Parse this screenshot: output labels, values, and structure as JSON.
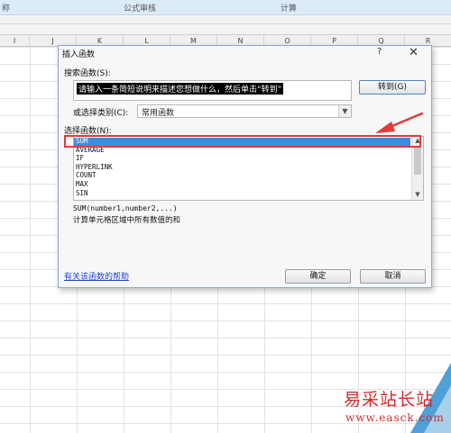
{
  "ribbon": {
    "left_fragment": "称",
    "group_audit": "公式审核",
    "group_calc": "计算"
  },
  "columns": [
    "I",
    "J",
    "K",
    "L",
    "M",
    "N",
    "O",
    "P",
    "Q",
    "R"
  ],
  "dialog": {
    "title": "插入函数",
    "help_glyph": "?",
    "close_glyph": "✕",
    "search_label": "搜索函数(S):",
    "search_value": "请输入一条简短说明来描述您想做什么，然后单击“转到”",
    "goto_button": "转到(G)",
    "category_label": "或选择类别(C):",
    "category_value": "常用函数",
    "function_list_label": "选择函数(N):",
    "functions": [
      "SUM",
      "AVERAGE",
      "IF",
      "HYPERLINK",
      "COUNT",
      "MAX",
      "SIN"
    ],
    "selected_function": "SUM",
    "signature": "SUM(number1,number2,...)",
    "description": "计算单元格区域中所有数值的和",
    "help_link": "有关该函数的帮助",
    "ok_button": "确定",
    "cancel_button": "取消"
  },
  "watermark": {
    "title": "易采站长站",
    "url": "www.easck.com"
  },
  "colors": {
    "highlight_red": "#e23a3a",
    "selection_blue": "#3c8de0",
    "watermark_red": "#d02a2a"
  }
}
